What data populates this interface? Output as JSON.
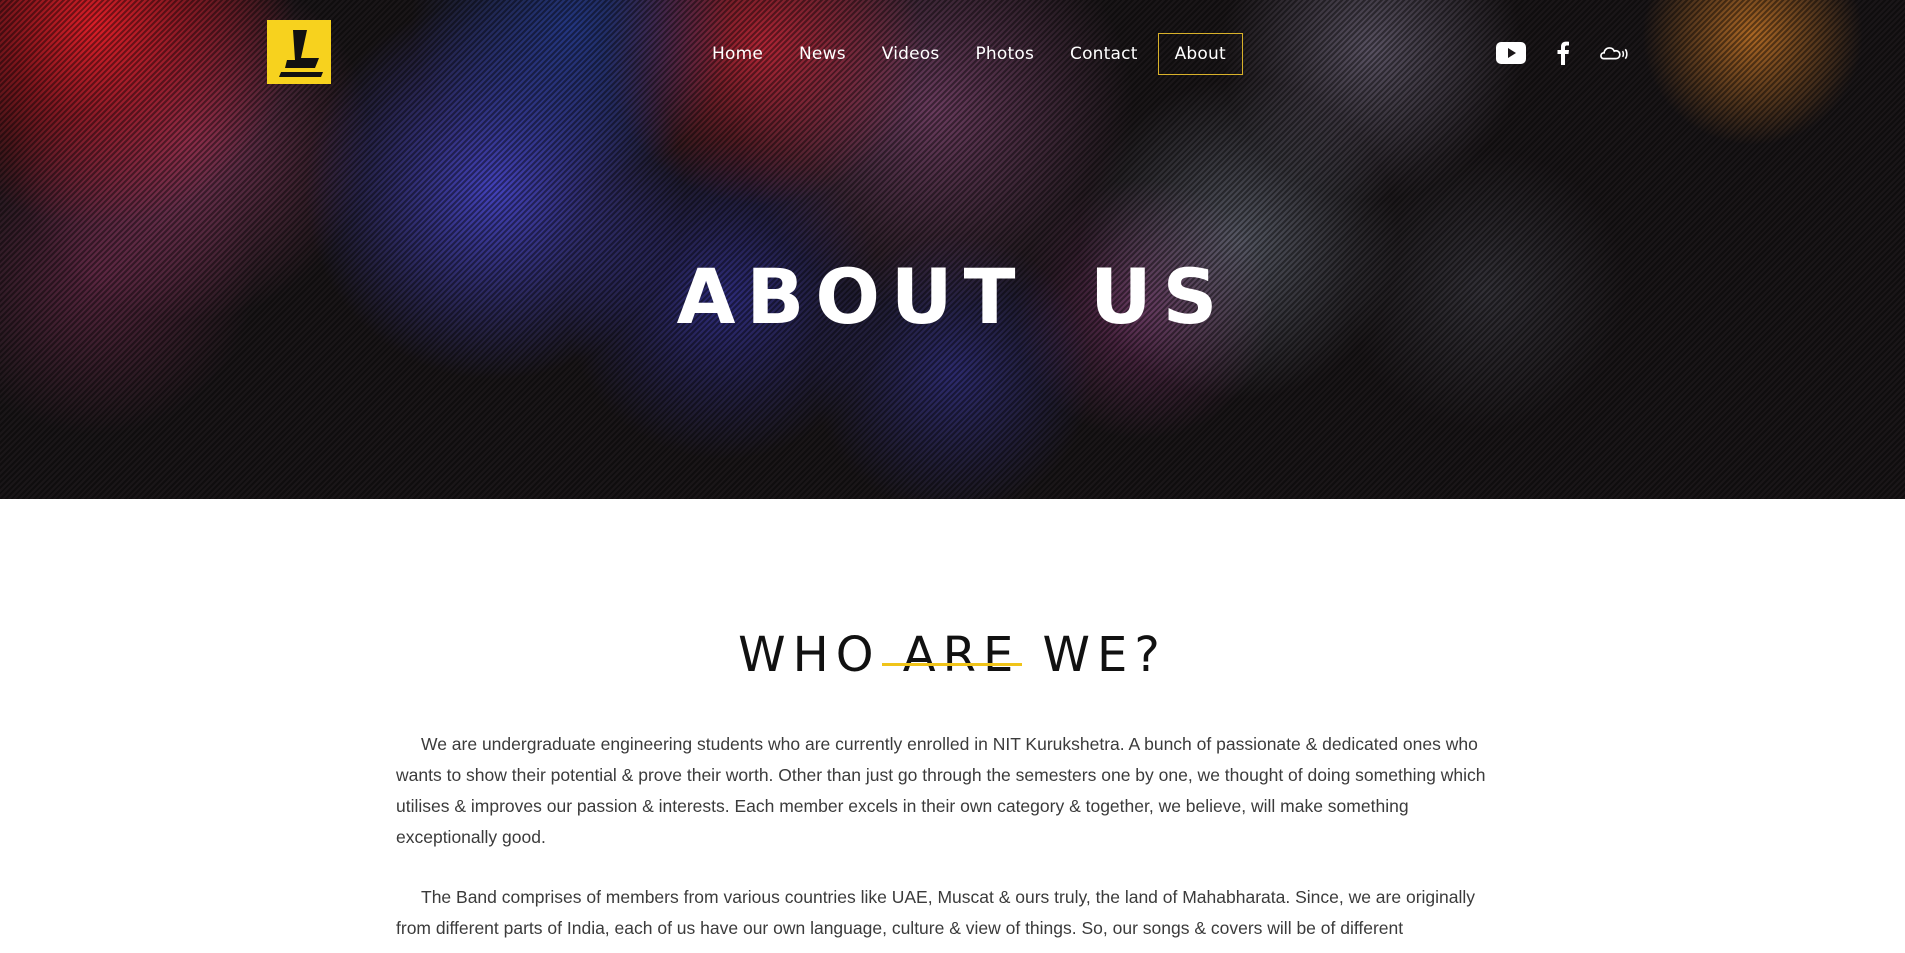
{
  "header": {
    "nav": [
      {
        "label": "Home"
      },
      {
        "label": "News"
      },
      {
        "label": "Videos"
      },
      {
        "label": "Photos"
      },
      {
        "label": "Contact"
      },
      {
        "label": "About",
        "active": true
      }
    ],
    "social_icons": [
      "youtube-icon",
      "facebook-icon",
      "soundcloud-icon"
    ],
    "logo_color": "#f7d21e",
    "active_border_color": "#d8b12a"
  },
  "hero": {
    "title": "ABOUT US"
  },
  "section": {
    "title": "WHO ARE WE?",
    "underline_color": "#f0c419",
    "paragraphs": [
      "We are undergraduate engineering students who are currently enrolled in NIT Kurukshetra.  A bunch of passionate & dedicated ones who wants to show their potential & prove their worth. Other than just go through the semesters one by one, we thought of doing something which utilises & improves our passion & interests. Each member excels in their own category & together, we believe, will make something exceptionally good.",
      "The Band comprises of members from various countries like UAE, Muscat & ours truly, the land of Mahabharata. Since, we are originally from different parts of India, each of us have our own language, culture & view of things. So, our songs & covers will be of different"
    ]
  }
}
